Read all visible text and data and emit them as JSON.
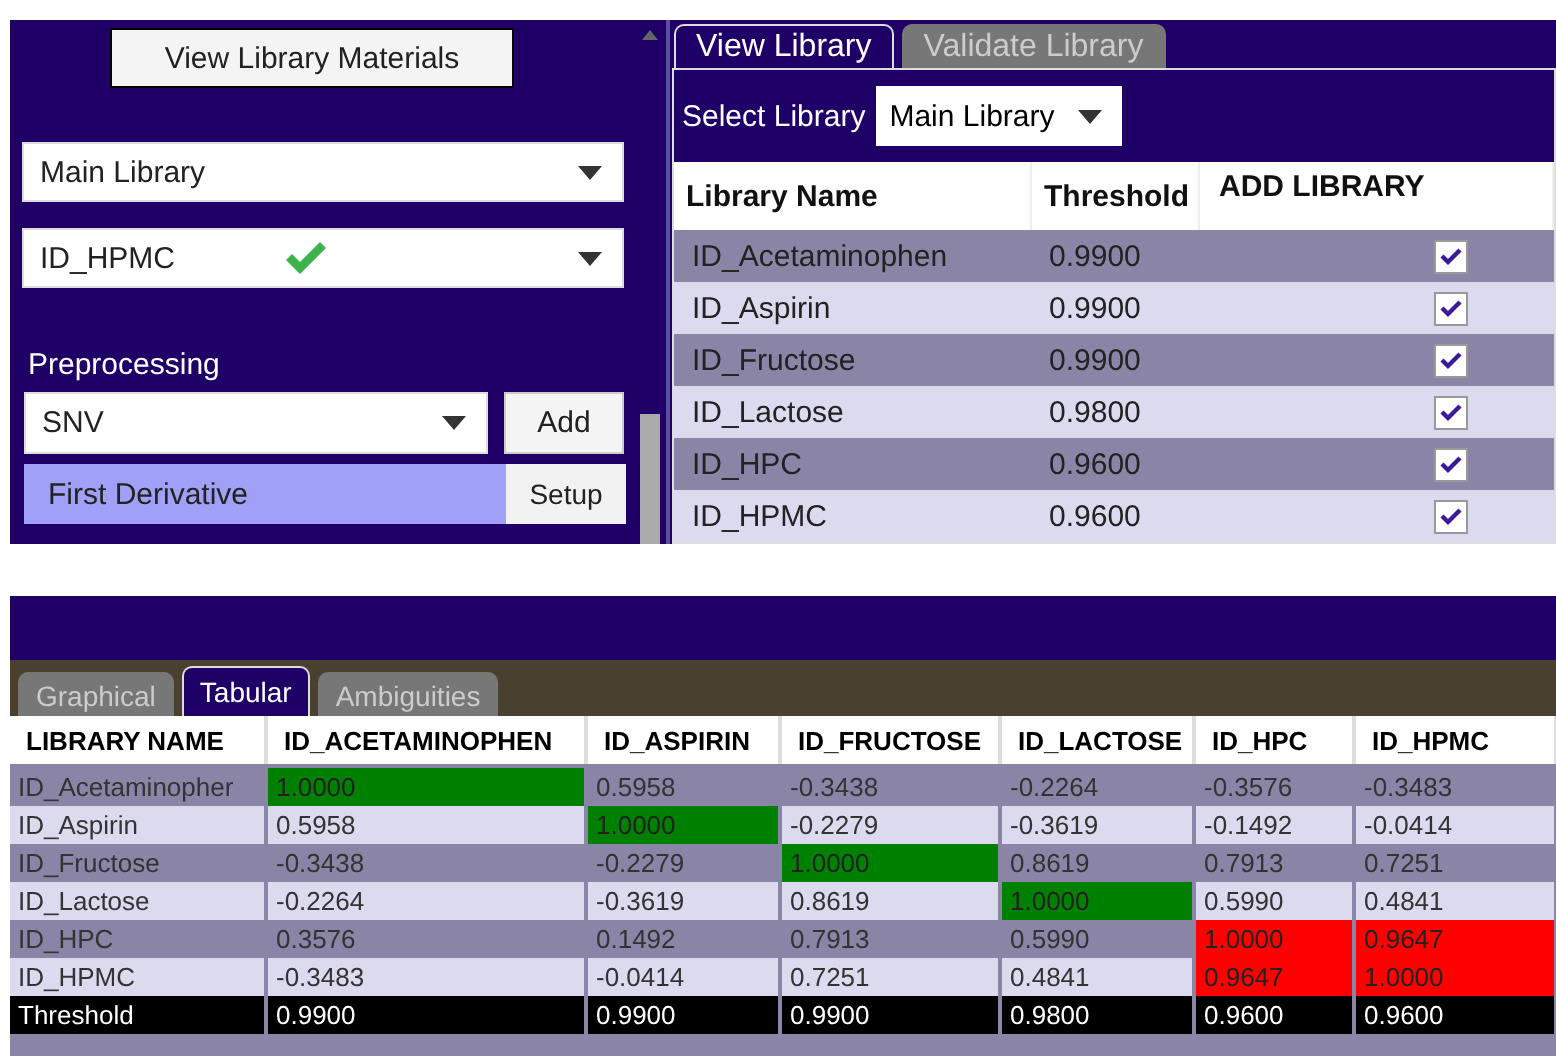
{
  "left_panel": {
    "view_materials_button": "View Library Materials",
    "library_dropdown": "Main Library",
    "material_dropdown": {
      "value": "ID_HPMC",
      "validated": true
    },
    "preprocessing_label": "Preprocessing",
    "method_dropdown": "SNV",
    "add_button": "Add",
    "steps": [
      {
        "name": "First Derivative",
        "button": "Setup",
        "selected": true
      }
    ]
  },
  "library_tabs": [
    {
      "label": "View Library",
      "selected": true
    },
    {
      "label": "Validate Library",
      "selected": false
    }
  ],
  "select_library": {
    "label": "Select Library",
    "value": "Main Library"
  },
  "library_table": {
    "columns": [
      "Library Name",
      "Threshold",
      "ADD LIBRARY"
    ],
    "rows": [
      {
        "name": "ID_Acetaminophen",
        "threshold": "0.9900",
        "checked": true
      },
      {
        "name": "ID_Aspirin",
        "threshold": "0.9900",
        "checked": true
      },
      {
        "name": "ID_Fructose",
        "threshold": "0.9900",
        "checked": true
      },
      {
        "name": "ID_Lactose",
        "threshold": "0.9800",
        "checked": true
      },
      {
        "name": "ID_HPC",
        "threshold": "0.9600",
        "checked": true
      },
      {
        "name": "ID_HPMC",
        "threshold": "0.9600",
        "checked": true
      }
    ]
  },
  "result_tabs": [
    {
      "label": "Graphical",
      "selected": false
    },
    {
      "label": "Tabular",
      "selected": true
    },
    {
      "label": "Ambiguities",
      "selected": false
    }
  ],
  "correlation_table": {
    "corner_header": "LIBRARY NAME",
    "columns": [
      "ID_ACETAMINOPHEN",
      "ID_ASPIRIN",
      "ID_FRUCTOSE",
      "ID_LACTOSE",
      "ID_HPC",
      "ID_HPMC"
    ],
    "rows": [
      {
        "name": "ID_Acetaminopher",
        "cells": [
          {
            "value": "1.0000",
            "color": "#008000"
          },
          {
            "value": "0.5958"
          },
          {
            "value": "-0.3438"
          },
          {
            "value": "-0.2264"
          },
          {
            "value": "-0.3576"
          },
          {
            "value": "-0.3483"
          }
        ]
      },
      {
        "name": "ID_Aspirin",
        "cells": [
          {
            "value": "0.5958"
          },
          {
            "value": "1.0000",
            "color": "#008000"
          },
          {
            "value": "-0.2279"
          },
          {
            "value": "-0.3619"
          },
          {
            "value": "-0.1492"
          },
          {
            "value": "-0.0414"
          }
        ]
      },
      {
        "name": "ID_Fructose",
        "cells": [
          {
            "value": "-0.3438"
          },
          {
            "value": "-0.2279"
          },
          {
            "value": "1.0000",
            "color": "#008000"
          },
          {
            "value": "0.8619"
          },
          {
            "value": "0.7913"
          },
          {
            "value": "0.7251"
          }
        ]
      },
      {
        "name": "ID_Lactose",
        "cells": [
          {
            "value": "-0.2264"
          },
          {
            "value": "-0.3619"
          },
          {
            "value": "0.8619"
          },
          {
            "value": "1.0000",
            "color": "#008000"
          },
          {
            "value": "0.5990"
          },
          {
            "value": "0.4841"
          }
        ]
      },
      {
        "name": "ID_HPC",
        "cells": [
          {
            "value": "0.3576"
          },
          {
            "value": "0.1492"
          },
          {
            "value": "0.7913"
          },
          {
            "value": "0.5990"
          },
          {
            "value": "1.0000",
            "color": "#ff0000"
          },
          {
            "value": "0.9647",
            "color": "#ff0000"
          }
        ]
      },
      {
        "name": "ID_HPMC",
        "cells": [
          {
            "value": "-0.3483"
          },
          {
            "value": "-0.0414"
          },
          {
            "value": "0.7251"
          },
          {
            "value": "0.4841"
          },
          {
            "value": "0.9647",
            "color": "#ff0000"
          },
          {
            "value": "1.0000",
            "color": "#ff0000"
          }
        ]
      }
    ],
    "threshold_row": {
      "label": "Threshold",
      "values": [
        "0.9900",
        "0.9900",
        "0.9900",
        "0.9800",
        "0.9600",
        "0.9600"
      ]
    }
  }
}
